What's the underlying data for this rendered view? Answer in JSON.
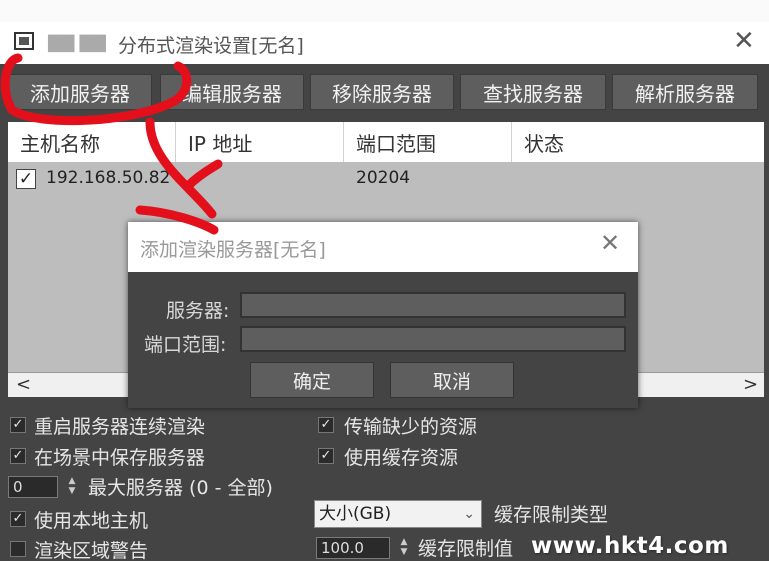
{
  "main_window": {
    "title": "分布式渲染设置[无名]",
    "close_glyph": "✕"
  },
  "toolbar": {
    "buttons": [
      "添加服务器",
      "编辑服务器",
      "移除服务器",
      "查找服务器",
      "解析服务器"
    ]
  },
  "server_table": {
    "columns": [
      "主机名称",
      "IP 地址",
      "端口范围",
      "状态"
    ],
    "rows": [
      {
        "checked": true,
        "host": "192.168.50.82",
        "ip": "",
        "port": "20204",
        "status": ""
      }
    ],
    "scroll_left": "<",
    "scroll_right": ">"
  },
  "options": {
    "restart_servers": {
      "label": "重启服务器连续渲染",
      "checked": true
    },
    "save_in_scene": {
      "label": "在场景中保存服务器",
      "checked": true
    },
    "max_servers": {
      "value": "0",
      "label": "最大服务器 (0 - 全部)"
    },
    "use_local_host": {
      "label": "使用本地主机",
      "checked": true
    },
    "region_warning": {
      "label": "渲染区域警告",
      "checked": false
    },
    "transfer_missing": {
      "label": "传输缺少的资源",
      "checked": true
    },
    "use_cache": {
      "label": "使用缓存资源",
      "checked": true
    },
    "cache_limit_type": {
      "value": "大小(GB)",
      "label": "缓存限制类型"
    },
    "cache_limit_value": {
      "value": "100.0",
      "label": "缓存限制值"
    }
  },
  "dialog": {
    "title": "添加渲染服务器[无名]",
    "close_glyph": "✕",
    "server_label": "服务器:",
    "server_value": "",
    "port_label": "端口范围:",
    "port_value": "",
    "ok_label": "确定",
    "cancel_label": "取消"
  },
  "watermark": "www.hkt4.com",
  "colors": {
    "window_bg": "#444444",
    "button_bg": "#5e5e5e",
    "table_bg": "#bdbdbd",
    "annotation_red": "#e3101c"
  }
}
